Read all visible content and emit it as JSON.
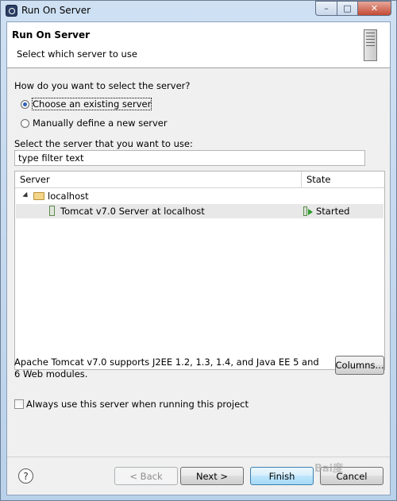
{
  "window": {
    "title": "Run On Server",
    "min_glyph": "–",
    "max_glyph": "□",
    "close_glyph": "✕"
  },
  "banner": {
    "title": "Run On Server",
    "subtitle": "Select which server to use"
  },
  "selection": {
    "question": "How do you want to select the server?",
    "options": [
      {
        "label": "Choose an existing server",
        "checked": true
      },
      {
        "label": "Manually define a new server",
        "checked": false
      }
    ]
  },
  "server_list": {
    "label": "Select the server that you want to use:",
    "filter_value": "type filter text",
    "columns": [
      "Server",
      "State"
    ],
    "host": "localhost",
    "servers": [
      {
        "name": "Tomcat v7.0 Server at localhost",
        "state": "Started"
      }
    ]
  },
  "description": "Apache Tomcat v7.0 supports J2EE 1.2, 1.3, 1.4, and Java EE 5 and 6 Web modules.",
  "columns_button": "Columns...",
  "always_use": {
    "label": "Always use this server when running this project",
    "checked": false
  },
  "footer": {
    "help_glyph": "?",
    "back": "< Back",
    "next": "Next >",
    "finish": "Finish",
    "cancel": "Cancel"
  },
  "watermark": "Bai度"
}
